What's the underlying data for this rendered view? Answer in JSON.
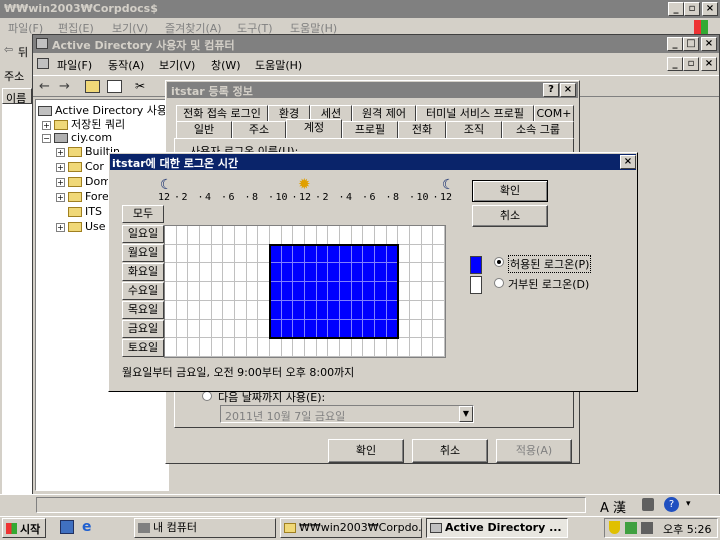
{
  "bg_window": {
    "title": "₩₩win2003₩Corpdocs$",
    "menu": [
      "파일(F)",
      "편집(E)",
      "보기(V)",
      "즐겨찾기(A)",
      "도구(T)",
      "도움말(H)"
    ],
    "toolbar_back": "뒤",
    "address_label": "주소",
    "name_header": "이름"
  },
  "ad_window": {
    "title": "Active Directory 사용자 및 컴퓨터",
    "menu": [
      "파일(F)",
      "동작(A)",
      "보기(V)",
      "창(W)",
      "도움말(H)"
    ],
    "tree": {
      "root": "Active Directory 사용자",
      "saved_queries": "저장된 쿼리",
      "domain": "ciy.com",
      "children": [
        "Builtin",
        "Cor",
        "Dom",
        "Fore",
        "ITS",
        "Use"
      ]
    }
  },
  "props_dialog": {
    "title": "itstar 등록 정보",
    "tabs_row1": [
      "전화 접속 로그인",
      "환경",
      "세션",
      "원격 제어",
      "터미널 서비스 프로필",
      "COM+"
    ],
    "tabs_row2": [
      "일반",
      "주소",
      "계정",
      "프로필",
      "전화",
      "조직",
      "소속 그룹"
    ],
    "logon_name_label": "사용자 로그온 이름(U):",
    "expire_label": "다음 날짜까지 사용(E):",
    "expire_date": "2011년 10월 7일 금요일",
    "ok": "확인",
    "cancel": "취소",
    "apply": "적용(A)"
  },
  "logon_dialog": {
    "title": "itstar에 대한 로그온 시간",
    "all_label": "모두",
    "days": [
      "일요일",
      "월요일",
      "화요일",
      "수요일",
      "목요일",
      "금요일",
      "토요일"
    ],
    "hours": [
      "12",
      "2",
      "4",
      "6",
      "8",
      "10",
      "12",
      "2",
      "4",
      "6",
      "8",
      "10",
      "12"
    ],
    "ok": "확인",
    "cancel": "취소",
    "allowed_label": "허용된 로그온(P)",
    "denied_label": "거부된 로그온(D)",
    "summary": "월요일부터 금요일, 오전 9:00부터 오후 8:00까지",
    "allowed_color": "#0000ff",
    "permitted": {
      "from_day": 1,
      "to_day": 5,
      "from_hour": 9,
      "to_hour": 20
    }
  },
  "status_bar": {
    "ime": "A 漢"
  },
  "taskbar": {
    "start": "시작",
    "buttons": [
      "내 컴퓨터",
      "₩₩win2003₩Corpdo...",
      "Active Directory ..."
    ],
    "clock": "오후 5:26"
  }
}
